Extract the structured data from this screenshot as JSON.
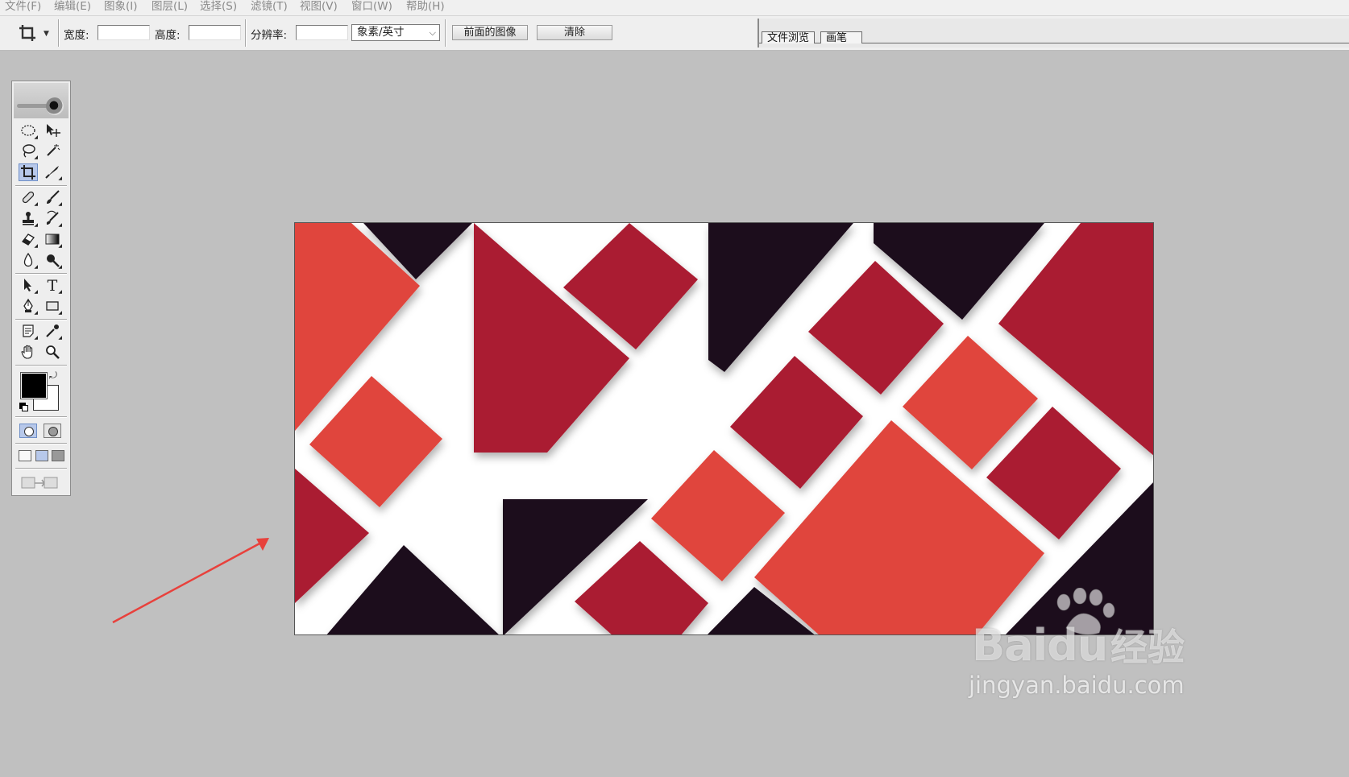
{
  "menu": {
    "file": "文件(F)",
    "edit": "编辑(E)",
    "image": "图象(I)",
    "layer": "图层(L)",
    "select": "选择(S)",
    "filter": "滤镜(T)",
    "view": "视图(V)",
    "window": "窗口(W)",
    "help": "帮助(H)"
  },
  "options": {
    "tool_icon": "crop-icon",
    "width_label": "宽度:",
    "width_value": "",
    "height_label": "高度:",
    "height_value": "",
    "resolution_label": "分辨率:",
    "resolution_value": "",
    "unit_select": "象素/英寸",
    "front_image_button": "前面的图像",
    "clear_button": "清除"
  },
  "palette_well": {
    "tabs": [
      "文件浏览",
      "画笔"
    ]
  },
  "toolbox": {
    "tools": [
      "marquee-icon",
      "move-icon",
      "lasso-icon",
      "magic-wand-icon",
      "crop-icon",
      "slice-icon",
      "healing-brush-icon",
      "brush-icon",
      "clone-stamp-icon",
      "history-brush-icon",
      "eraser-icon",
      "gradient-icon",
      "blur-icon",
      "dodge-icon",
      "path-selection-icon",
      "type-icon",
      "pen-icon",
      "shape-icon",
      "notes-icon",
      "eyedropper-icon",
      "hand-icon",
      "zoom-icon"
    ],
    "active_tool": "crop-icon",
    "foreground_color": "#000000",
    "background_color": "#ffffff"
  },
  "document": {
    "colors": {
      "dark": "#1e0c1e",
      "crimson": "#aa1c30",
      "coral": "#e0453c",
      "white": "#ffffff"
    }
  },
  "annotation": {
    "arrow_color": "#e8413c"
  },
  "watermark": {
    "brand": "Bai",
    "brand_tail": "du",
    "cn_text": "经验",
    "url": "jingyan.baidu.com"
  }
}
